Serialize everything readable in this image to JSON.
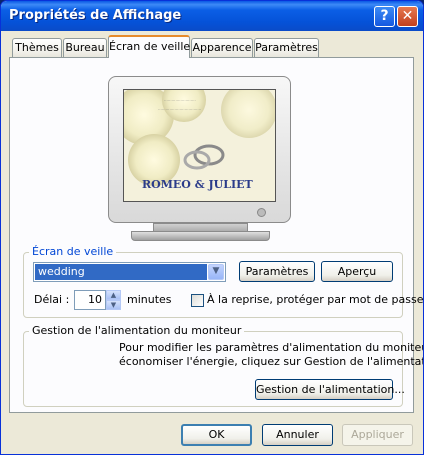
{
  "window": {
    "title": "Propriétés de Affichage",
    "help": "?",
    "close": "✕"
  },
  "tabs": [
    {
      "label": "Thèmes"
    },
    {
      "label": "Bureau"
    },
    {
      "label": "Écran de veille"
    },
    {
      "label": "Apparence"
    },
    {
      "label": "Paramètres"
    }
  ],
  "preview": {
    "caption": "ROMEO & JULIET"
  },
  "screensaver": {
    "group_label": "Écran de veille",
    "selected": "wedding",
    "settings_button": "Paramètres",
    "preview_button": "Aperçu",
    "delay_label": "Délai :",
    "delay_value": "10",
    "minutes_label": "minutes",
    "password_checkbox_label": "À la reprise, protéger par mot de passe",
    "password_checked": false
  },
  "power": {
    "group_label": "Gestion de l'alimentation du moniteur",
    "description_line1": "Pour modifier les paramètres d'alimentation du moniteur et",
    "description_line2": "économiser l'énergie, cliquez sur Gestion de l'alimentation.",
    "button": "Gestion de l'alimentation..."
  },
  "footer": {
    "ok": "OK",
    "cancel": "Annuler",
    "apply": "Appliquer"
  },
  "colors": {
    "accent": "#0046d5",
    "selection": "#316ac5",
    "titlebar": "#0552d8"
  }
}
